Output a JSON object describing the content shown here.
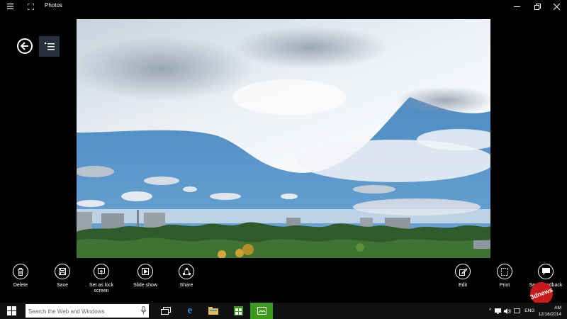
{
  "window": {
    "title": "Photos",
    "icons": {
      "menu": "hamburger-icon",
      "fullscreen": "expand-icon",
      "minimize": "minimize-icon",
      "restore": "restore-icon",
      "close": "close-icon"
    }
  },
  "nav": {
    "back_icon": "back-arrow-icon",
    "list_icon": "collection-list-icon"
  },
  "photo": {
    "description_icon": "photo-image"
  },
  "appbar": {
    "left": [
      {
        "label": "Delete",
        "icon": "trash-icon"
      },
      {
        "label": "Save",
        "icon": "save-icon"
      },
      {
        "label": "Set as lock screen",
        "icon": "lock-screen-icon"
      },
      {
        "label": "Slide show",
        "icon": "play-icon"
      },
      {
        "label": "Share",
        "icon": "share-icon"
      }
    ],
    "right": [
      {
        "label": "Edit",
        "icon": "edit-icon"
      },
      {
        "label": "Print",
        "icon": "print-icon"
      },
      {
        "label": "Send feedback",
        "icon": "feedback-icon"
      }
    ]
  },
  "taskbar": {
    "search_placeholder": "Search the Web and Windows",
    "apps": [
      "task-view-icon",
      "internet-explorer-icon",
      "file-explorer-icon",
      "store-icon",
      "photos-app-icon"
    ],
    "tray": {
      "language": "ENG",
      "time": "AM",
      "date": "12/16/2014"
    },
    "accent": "#3a9a1a"
  },
  "watermark": {
    "text": "3dnews"
  }
}
